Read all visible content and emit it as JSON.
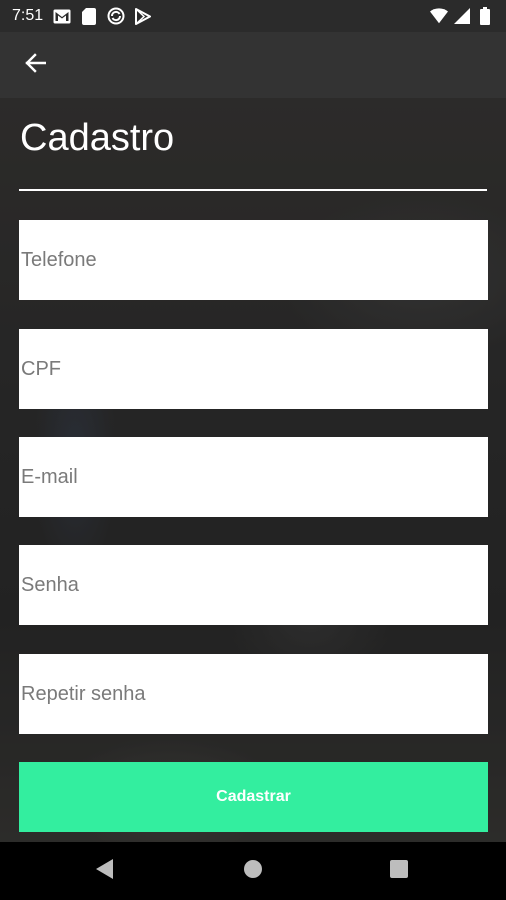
{
  "status_bar": {
    "time": "7:51",
    "left_icons": [
      "gmail-icon",
      "sd-card-icon",
      "sync-icon",
      "play-store-icon"
    ],
    "right_icons": [
      "wifi-icon",
      "signal-icon",
      "battery-icon"
    ]
  },
  "app_bar": {
    "back_icon": "arrow-back-icon"
  },
  "form": {
    "title": "Cadastro",
    "fields": [
      {
        "name": "telefone",
        "placeholder": "Telefone",
        "value": ""
      },
      {
        "name": "cpf",
        "placeholder": "CPF",
        "value": ""
      },
      {
        "name": "email",
        "placeholder": "E-mail",
        "value": ""
      },
      {
        "name": "senha",
        "placeholder": "Senha",
        "value": ""
      },
      {
        "name": "repetir_senha",
        "placeholder": "Repetir senha",
        "value": ""
      }
    ],
    "submit_label": "Cadastrar"
  },
  "colors": {
    "accent": "#33ee9f",
    "app_bar": "#333333",
    "status_bar": "#2b2b2b",
    "nav_bar": "#000000"
  },
  "nav_bar": {
    "buttons": [
      "back-triangle-icon",
      "home-circle-icon",
      "recents-square-icon"
    ]
  }
}
